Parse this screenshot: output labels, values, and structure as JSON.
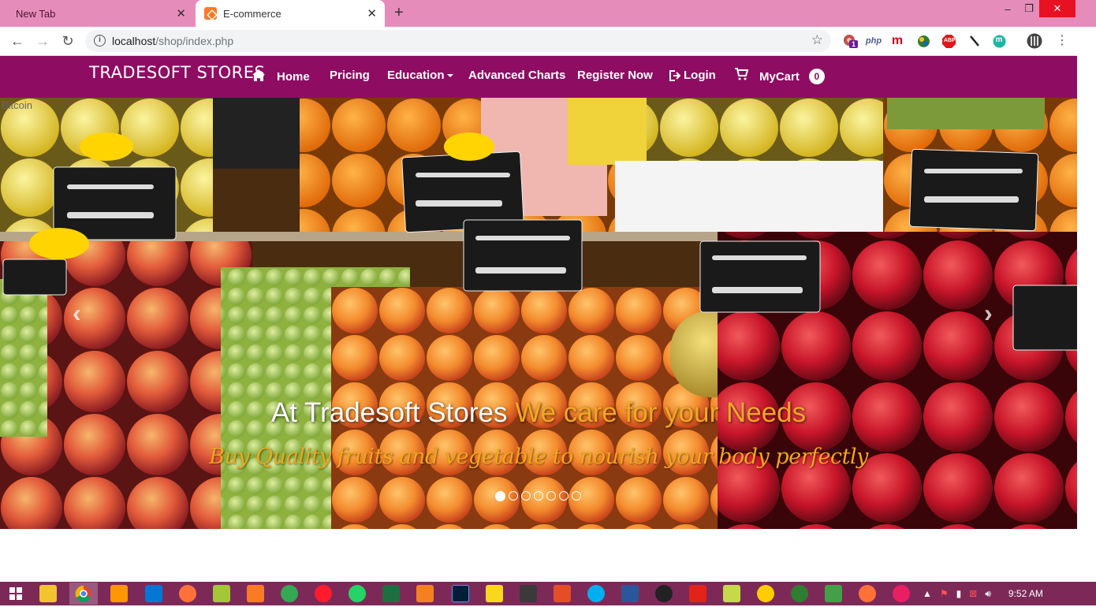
{
  "browser": {
    "tabs": [
      {
        "label": "New Tab"
      },
      {
        "label": "E-commerce"
      }
    ],
    "new_tab_symbol": "+",
    "window_controls": {
      "minimize": "–",
      "restore": "❐",
      "close": "✕"
    },
    "address": {
      "host": "localhost",
      "path": "/shop/index.php"
    },
    "extensions": {
      "php_label": "php",
      "m_label": "m",
      "abp_label": "ABP",
      "badge_count": "1"
    }
  },
  "site": {
    "brand": "TRADESOFT STORES",
    "nav": {
      "home": "Home",
      "pricing": "Pricing",
      "education": "Education",
      "advanced_charts": "Advanced Charts",
      "register": "Register Now",
      "login": "Login",
      "cart": "MyCart",
      "cart_count": "0"
    },
    "carousel": {
      "image_alt": "Bitcoin",
      "caption_part1": "At Tradesoft Stores",
      "caption_part2": "We care for your Needs",
      "subcaption": "Buy Quality fruits and vegetable to nourish your body perfectly",
      "slide_count": 7,
      "active_slide": 1
    }
  },
  "taskbar": {
    "time": "9:52 AM"
  },
  "colors": {
    "tab_strip": "#e68cba",
    "navbar": "#8f0c63",
    "caption_highlight": "#f5a623",
    "taskbar": "#7c2958"
  }
}
